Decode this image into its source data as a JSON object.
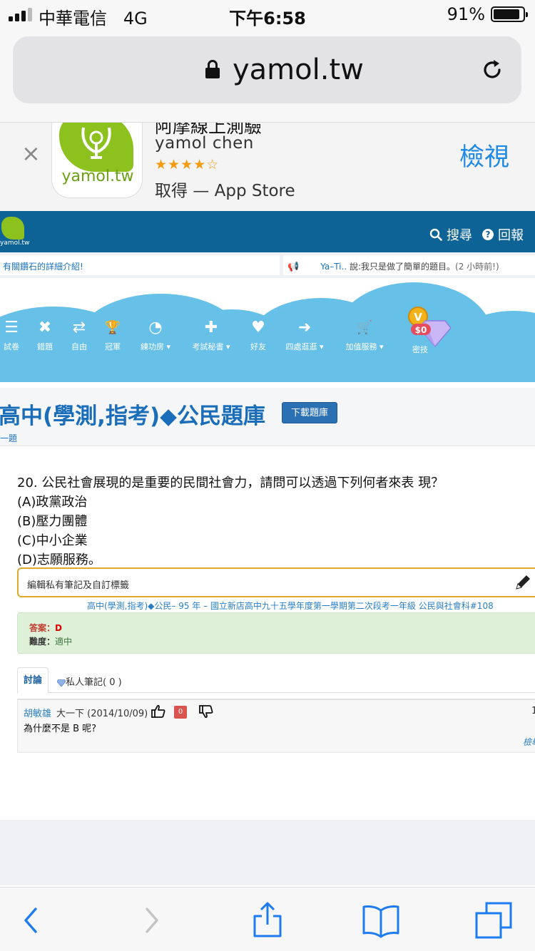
{
  "status_bar": {
    "carrier": "中華電信",
    "network": "4G",
    "time": "下午6:58",
    "battery_percent": "91%",
    "battery_level": 0.91
  },
  "browser": {
    "url": "yamol.tw"
  },
  "app_banner": {
    "title": "阿摩線上測驗",
    "developer": "yamol chen",
    "rating_stars": "★★★★☆",
    "store_text": "取得 — App Store",
    "view_label": "檢視",
    "icon_text": "yamol.tw",
    "close_glyph": "×"
  },
  "site_header": {
    "logo_text": "yamol.tw",
    "search_label": "搜尋",
    "back_label": "回報"
  },
  "ticker": {
    "left_text": "有關鑽石的詳細介紹!",
    "user": "Ya–Ti..",
    "message": " 說:我只是做了簡單的題目。",
    "time_ago": "(2 小時前!)"
  },
  "nav": {
    "items": [
      {
        "label": "試卷",
        "icon": "menu-icon",
        "glyph": "☰"
      },
      {
        "label": "錯題",
        "icon": "close-icon",
        "glyph": "✖"
      },
      {
        "label": "自由",
        "icon": "shuffle-icon",
        "glyph": "⇄"
      },
      {
        "label": "冠軍",
        "icon": "trophy-icon",
        "glyph": "🏆"
      },
      {
        "label": "練功房 ▾",
        "icon": "dashboard-icon",
        "glyph": "◔"
      },
      {
        "label": "考試秘書 ▾",
        "icon": "medkit-icon",
        "glyph": "✚"
      },
      {
        "label": "好友",
        "icon": "heart-icon",
        "glyph": "♥"
      },
      {
        "label": "四處逛逛 ▾",
        "icon": "sign-out-icon",
        "glyph": "➜"
      },
      {
        "label": "加值服務 ▾",
        "icon": "cart-icon",
        "glyph": "🛒"
      }
    ],
    "secret_label": "密技",
    "secret_badge": "$0",
    "coin_letter": "V"
  },
  "title_section": {
    "title": "高中(學測,指考)◆公民題庫",
    "download_button": "下載題庫",
    "prev_link": "一題"
  },
  "question": {
    "text": "20. 公民社會展現的是重要的民間社會力，請問可以透過下列何者來表 現？",
    "options": [
      "(A)政黨政治",
      "(B)壓力團體",
      "(C)中小企業",
      "(D)志願服務。"
    ]
  },
  "notes": {
    "label": "編輯私有筆記及自訂標籤"
  },
  "source": {
    "text": "高中(學測,指考)◆公民– 95 年 – 國立新店高中九十五學年度第一學期第二次段考一年級 公民與社會科#108"
  },
  "answer": {
    "answer_key": "答案：",
    "answer_value": "D",
    "difficulty_key": "難度：",
    "difficulty_value": "適中"
  },
  "tabs": {
    "discuss": "討論",
    "private_notes": "私人筆記( 0 )"
  },
  "comment": {
    "author": "胡敏雄",
    "meta": "大一下 (2014/10/09)",
    "votes": "0",
    "body": "為什麼不是 B 呢?",
    "count": "1",
    "more": "檢舉"
  },
  "colors": {
    "header_blue": "#0d6396",
    "sky_blue": "#66c0e8",
    "title_blue": "#1a6db8",
    "answer_green_bg": "#dff0d8",
    "notes_border": "#e0a92c",
    "ios_blue": "#1e88e5"
  }
}
